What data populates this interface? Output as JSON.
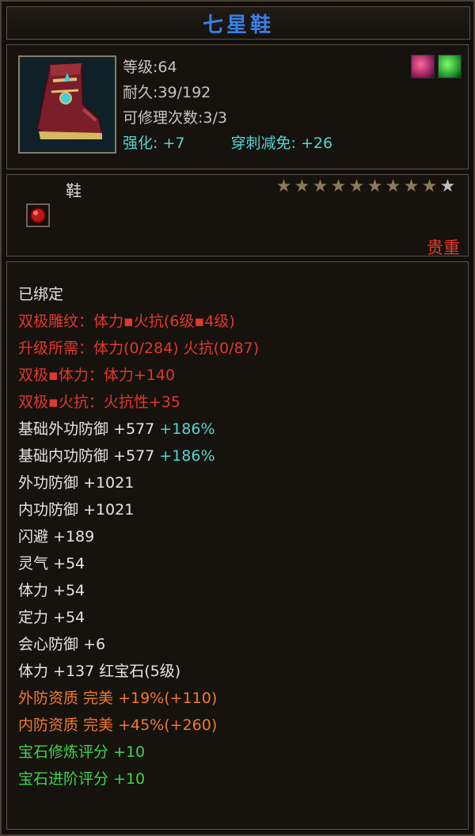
{
  "title": "七星鞋",
  "item": {
    "level_label": "等级:64",
    "durability_label": "耐久:39/192",
    "repair_label": "可修理次数:3/3",
    "enhance_label": "强化: +7",
    "pierce_label": "穿刺减免: +26",
    "type": "鞋",
    "rarity": "贵重",
    "stars_filled": 9,
    "stars_total": 10
  },
  "colors": {
    "title": "#3a7fe6",
    "star_filled": "#8c7a55",
    "star_empty": "#bdbdbd"
  },
  "attributes": [
    {
      "text": "已绑定",
      "color": "white"
    },
    {
      "text": "双极雕纹：体力▪火抗(6级▪4级)",
      "color": "red"
    },
    {
      "text": "升级所需：体力(0/284)  火抗(0/87)",
      "color": "red"
    },
    {
      "text": "双极▪体力：体力+140",
      "color": "red"
    },
    {
      "text": "双极▪火抗：火抗性+35",
      "color": "red"
    },
    {
      "text": "基础外功防御 +577 ",
      "color": "white",
      "extra": "+186%",
      "extra_color": "cyan"
    },
    {
      "text": "基础内功防御 +577 ",
      "color": "white",
      "extra": "+186%",
      "extra_color": "cyan"
    },
    {
      "text": "外功防御 +1021",
      "color": "white"
    },
    {
      "text": "内功防御 +1021",
      "color": "white"
    },
    {
      "text": "闪避 +189",
      "color": "white"
    },
    {
      "text": "灵气 +54",
      "color": "white"
    },
    {
      "text": "体力 +54",
      "color": "white"
    },
    {
      "text": "定力 +54",
      "color": "white"
    },
    {
      "text": "会心防御 +6",
      "color": "white"
    },
    {
      "text": "体力 +137 红宝石(5级)",
      "color": "white"
    },
    {
      "text": "外防资质  完美 +19%(+110)",
      "color": "orange"
    },
    {
      "text": "内防资质  完美 +45%(+260)",
      "color": "orange"
    },
    {
      "text": "宝石修炼评分 +10",
      "color": "green"
    },
    {
      "text": "宝石进阶评分 +10",
      "color": "green"
    }
  ]
}
